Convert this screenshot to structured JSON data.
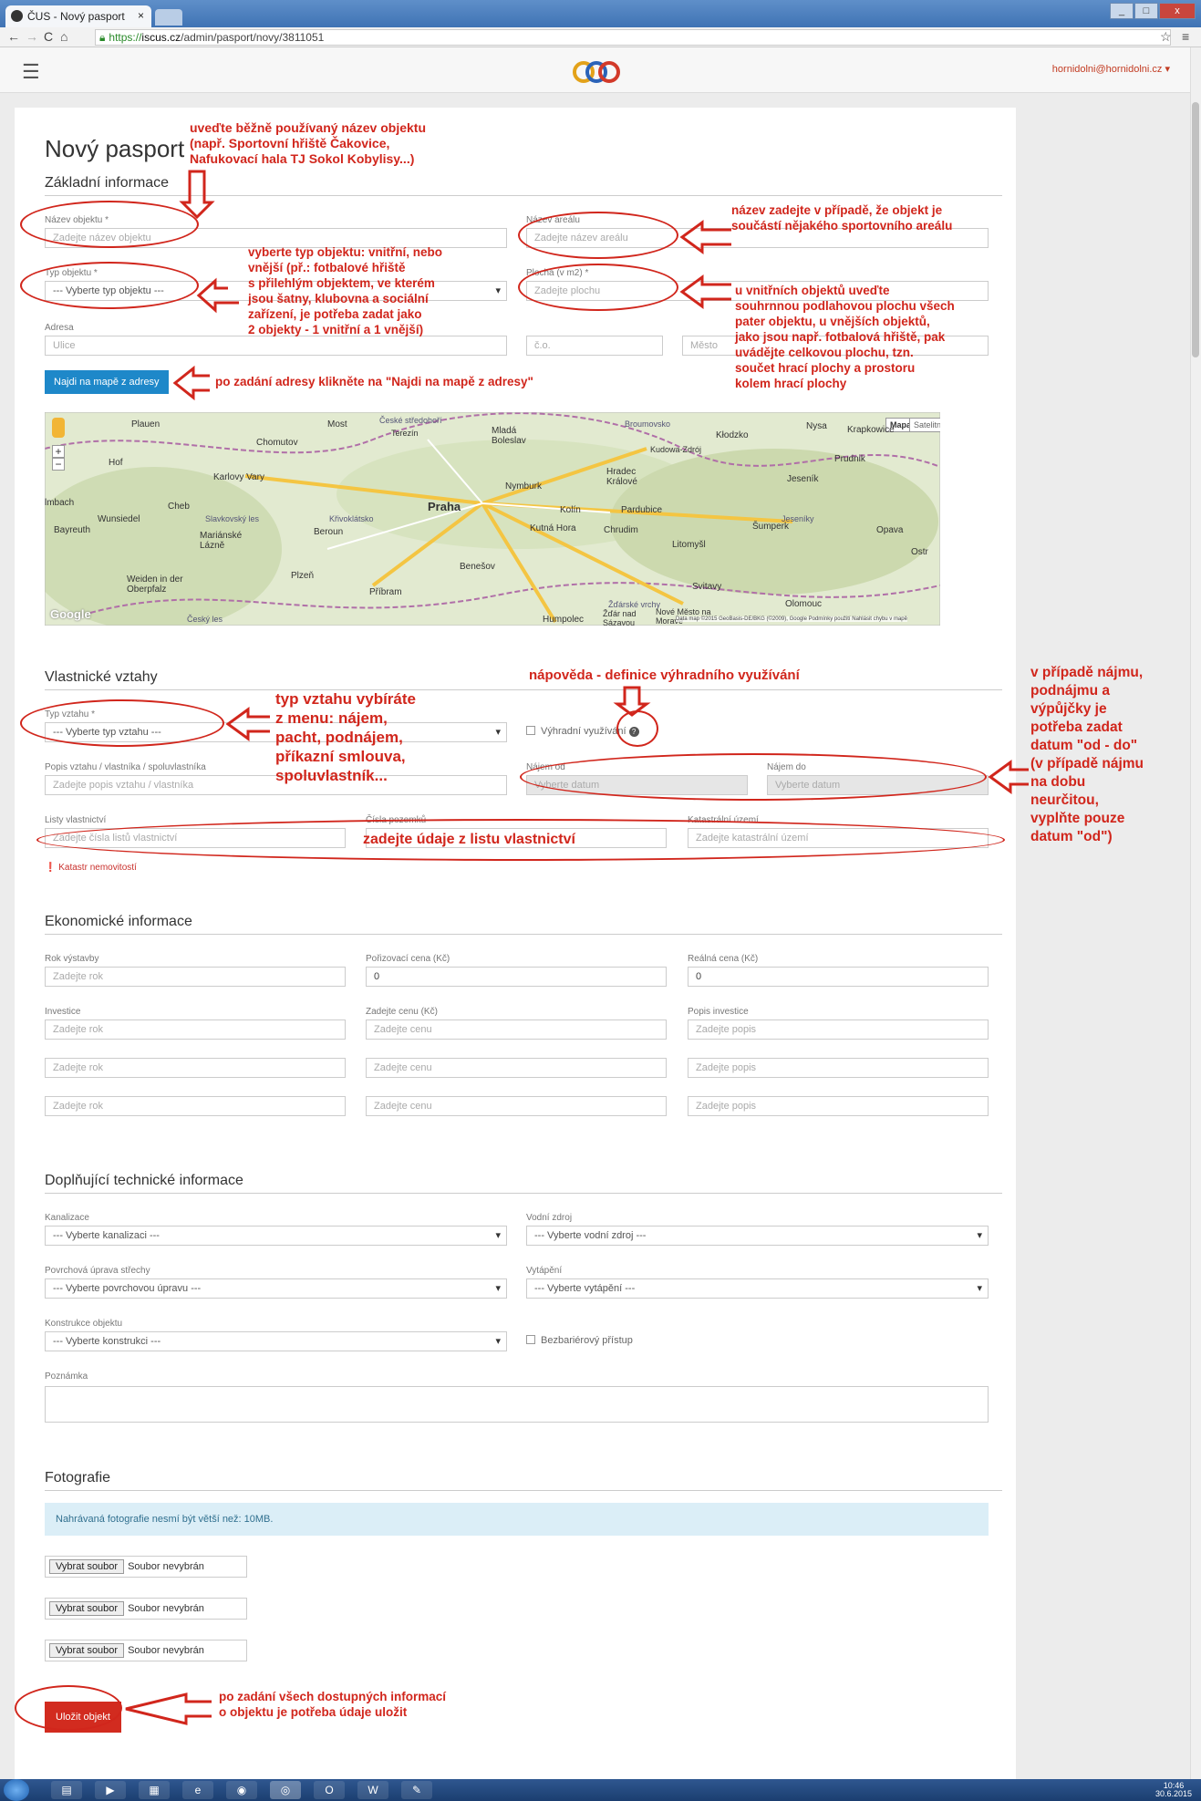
{
  "browser": {
    "tab_title": "ČUS - Nový pasport",
    "tab_close": "×",
    "url_scheme": "https://",
    "url_host": "iscus.cz",
    "url_path": "/admin/pasport/novy/3811051",
    "win_min": "_",
    "win_max": "□",
    "win_close": "x"
  },
  "app": {
    "user_email": "hornidolni@hornidolni.cz ▾"
  },
  "page": {
    "title": "Nový pasport",
    "basic": {
      "heading": "Základní informace",
      "nazev_label": "Název objektu *",
      "nazev_placeholder": "Zadejte název objektu",
      "areal_label": "Název areálu",
      "areal_placeholder": "Zadejte název areálu",
      "typ_label": "Typ objektu *",
      "typ_value": "--- Vyberte typ objektu ---",
      "plocha_label": "Plocha (v m2) *",
      "plocha_placeholder": "Zadejte plochu",
      "adresa_label": "Adresa",
      "ulice_placeholder": "Ulice",
      "co_placeholder": "č.o.",
      "mesto_placeholder": "Město",
      "find_button": "Najdi na mapě z adresy"
    },
    "map": {
      "toggle_map": "Mapa",
      "toggle_sat": "Satelitní",
      "zoom_in": "+",
      "zoom_out": "−",
      "google": "Google",
      "attribution": "Data map ©2015 GeoBasis-DE/BKG (©2009), Google   Podmínky použití   Nahlásit chybu v mapě",
      "cities": [
        "Plauen",
        "Most",
        "Mladá Boleslav",
        "Nysa",
        "Krapkowice",
        "Chomutov",
        "Kłodzko",
        "Hof",
        "Karlovy Vary",
        "Nymburk",
        "Hradec Králové",
        "Prudnik",
        "Jeseník",
        "Praha",
        "Kolín",
        "Pardubice",
        "Šumperk",
        "Cheb",
        "Wunsiedel",
        "Kutná Hora",
        "Chrudim",
        "Opava",
        "Bayreuth",
        "Mariánské Lázně",
        "Litomyšl",
        "Ostr",
        "Beroun",
        "Plzeň",
        "Benešov",
        "Svitavy",
        "Weiden in der Oberpfalz",
        "Příbram",
        "Olomouc",
        "Humpolec",
        "Žďár nad Sázavou",
        "Nové Město na Moravě",
        "Kudowa-Zdrój",
        "lmbach",
        "Slavkovský les",
        "Křivoklátsko",
        "Broumovsko",
        "Jeseníky",
        "České středohoří",
        "Žďárské vrchy",
        "Český les",
        "Terezín"
      ]
    },
    "ownership": {
      "heading": "Vlastnické vztahy",
      "typ_label": "Typ vztahu *",
      "typ_value": "--- Vyberte typ vztahu ---",
      "vyhradni_label": "Výhradní využívání",
      "help_icon": "?",
      "popis_label": "Popis vztahu / vlastníka / spoluvlastníka",
      "popis_placeholder": "Zadejte popis vztahu / vlastníka",
      "od_label": "Nájem od",
      "od_placeholder": "Vyberte datum",
      "do_label": "Nájem do",
      "do_placeholder": "Vyberte datum",
      "listy_label": "Listy vlastnictví",
      "listy_placeholder": "Zadejte čísla listů vlastnictví",
      "pozemku_label": "Čísla pozemků",
      "katastr_label": "Katastrální území",
      "katastr_placeholder": "Zadejte katastrální území",
      "katastr_link": "Katastr nemovitostí"
    },
    "economic": {
      "heading": "Ekonomické informace",
      "rok_label": "Rok výstavby",
      "rok_placeholder": "Zadejte rok",
      "porizovaci_label": "Pořizovací cena (Kč)",
      "porizovaci_value": "0",
      "realna_label": "Reálná cena (Kč)",
      "realna_value": "0",
      "investice_label": "Investice",
      "cena_label": "Zadejte cenu (Kč)",
      "popis_label": "Popis investice",
      "rows": [
        {
          "rok": "Zadejte rok",
          "cena": "Zadejte cenu",
          "popis": "Zadejte popis"
        },
        {
          "rok": "Zadejte rok",
          "cena": "Zadejte cenu",
          "popis": "Zadejte popis"
        },
        {
          "rok": "Zadejte rok",
          "cena": "Zadejte cenu",
          "popis": "Zadejte popis"
        }
      ]
    },
    "technical": {
      "heading": "Doplňující technické informace",
      "kanalizace_label": "Kanalizace",
      "kanalizace_value": "--- Vyberte kanalizaci ---",
      "voda_label": "Vodní zdroj",
      "voda_value": "--- Vyberte vodní zdroj ---",
      "strecha_label": "Povrchová úprava střechy",
      "strecha_value": "--- Vyberte povrchovou úpravu ---",
      "vytapeni_label": "Vytápění",
      "vytapeni_value": "--- Vyberte vytápění ---",
      "konstrukce_label": "Konstrukce objektu",
      "konstrukce_value": "--- Vyberte konstrukci ---",
      "bezbarier_label": "Bezbariérový přístup",
      "poznamka_label": "Poznámka"
    },
    "photos": {
      "heading": "Fotografie",
      "info": "Nahrávaná fotografie nesmí být větší než: 10MB.",
      "file_button": "Vybrat soubor",
      "file_status": "Soubor nevybrán"
    },
    "save_button": "Uložit objekt"
  },
  "annotations": {
    "a1": "uveďte běžně používaný název objektu\n(např. Sportovní hřiště Čakovice,\nNafukovací hala TJ Sokol Kobylisy...)",
    "a2": "název zadejte v případě, že objekt je\nsoučástí nějakého sportovního areálu",
    "a3": "vyberte typ objektu: vnitřní, nebo\nvnější (př.: fotbalové hřiště\ns přilehlým objektem, ve kterém\njsou šatny, klubovna a sociální\nzařízení, je potřeba zadat jako\n2 objekty - 1 vnitřní a 1 vnější)",
    "a4": "u vnitřních objektů uveďte\nsouhrnnou podlahovou plochu všech\npater objektu, u vnějších objektů,\njako jsou např. fotbalová hřiště, pak\nuvádějte celkovou plochu, tzn.\nsoučet hrací plochy a prostoru\nkolem hrací plochy",
    "a5": "po zadání adresy klikněte na \"Najdi na mapě z adresy\"",
    "a6": "nápověda - definice výhradního využívání",
    "a7": "typ vztahu vybíráte\nz menu: nájem,\npacht, podnájem,\npříkazní smlouva,\nspoluvlastník...",
    "a8": "v případě nájmu,\npodnájmu a\nvýpůjčky je\npotřeba zadat\ndatum \"od - do\"\n(v případě nájmu\nna dobu\nneurčitou,\nvyplňte pouze\ndatum \"od\")",
    "a9": "zadejte údaje z listu vlastnictví",
    "a10": "po zadání všech dostupných informací\no objektu je potřeba údaje uložit"
  },
  "taskbar": {
    "time": "10:46",
    "date": "30.6.2015"
  }
}
